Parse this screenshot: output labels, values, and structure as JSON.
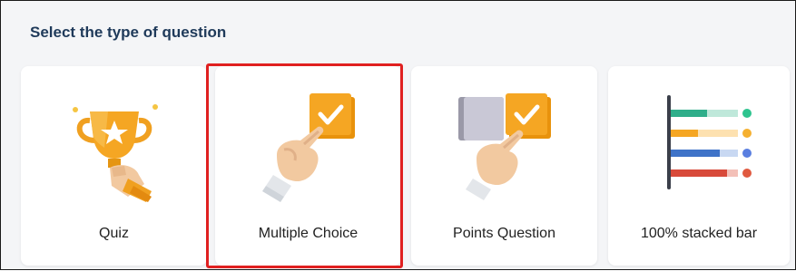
{
  "panel": {
    "title": "Select the type of question"
  },
  "question_types": [
    {
      "label": "Quiz",
      "icon": "trophy-icon"
    },
    {
      "label": "Multiple Choice",
      "icon": "hand-checkbox-icon",
      "selected": true
    },
    {
      "label": "Points Question",
      "icon": "hand-two-boxes-icon"
    },
    {
      "label": "100% stacked bar",
      "icon": "stacked-bar-chart-icon"
    }
  ],
  "colors": {
    "title": "#1f3a5a",
    "accent_orange": "#f5a623",
    "selection_outline": "#e02020",
    "card_background": "#ffffff",
    "panel_background": "#f4f5f7"
  }
}
